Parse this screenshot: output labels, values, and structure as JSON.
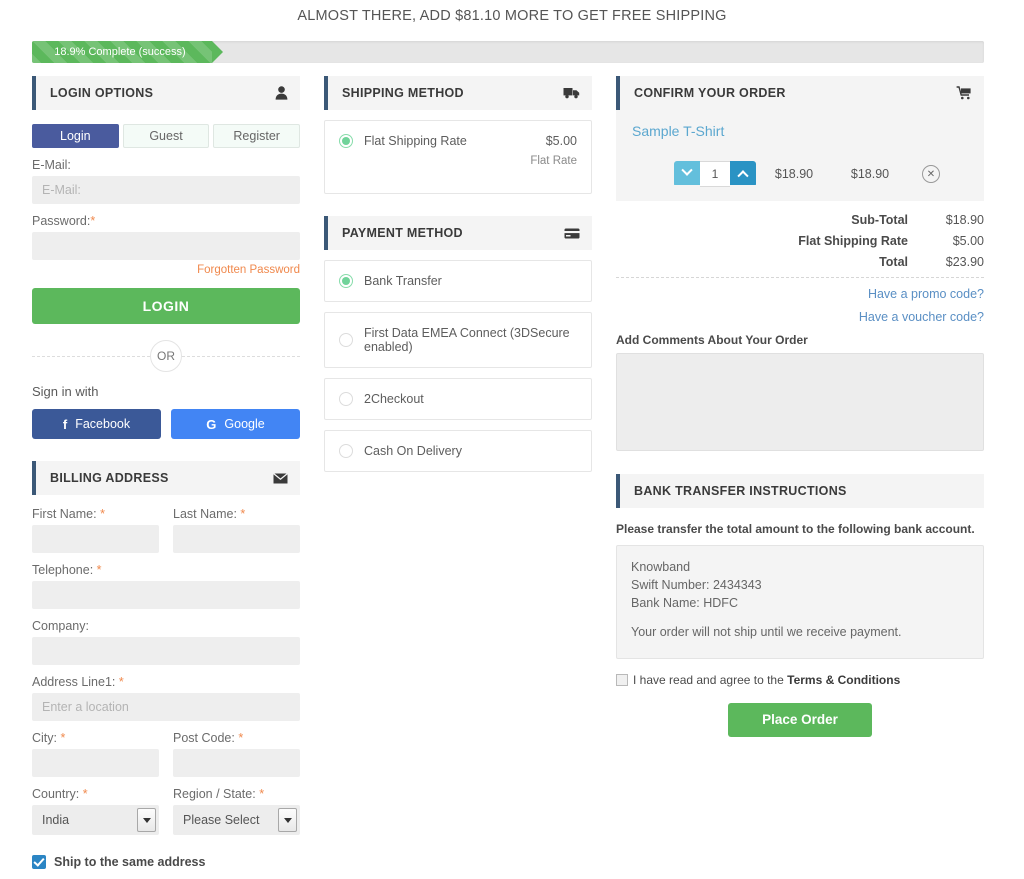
{
  "banner": {
    "free_shipping_message": "ALMOST THERE, ADD $81.10 MORE TO GET FREE SHIPPING"
  },
  "progress": {
    "label": "18.9% Complete (success)",
    "percent": "18.9",
    "bar_color": "#5cb85c",
    "track_color": "#e6e6e6"
  },
  "login_panel": {
    "title": "LOGIN OPTIONS",
    "icon": "user-icon",
    "tabs": [
      {
        "label": "Login",
        "active": true
      },
      {
        "label": "Guest",
        "active": false
      },
      {
        "label": "Register",
        "active": false
      }
    ],
    "email_label": "E-Mail:",
    "email_placeholder": "E-Mail:",
    "email_value": "",
    "password_label": "Password:",
    "password_required": "*",
    "password_value": "",
    "forgotten_password": "Forgotten Password",
    "login_button": "LOGIN",
    "or_text": "OR",
    "sign_in_with": "Sign in with",
    "facebook_label": "Facebook",
    "facebook_glyph": "f",
    "facebook_color": "#3b5998",
    "google_label": "Google",
    "google_glyph": "G",
    "google_color": "#4285f4"
  },
  "billing_panel": {
    "title": "BILLING ADDRESS",
    "icon": "envelope-icon",
    "first_name_label": "First Name:",
    "first_name_value": "",
    "last_name_label": "Last Name:",
    "last_name_value": "",
    "telephone_label": "Telephone:",
    "telephone_value": "",
    "company_label": "Company:",
    "company_value": "",
    "address1_label": "Address Line1:",
    "address1_placeholder": "Enter a location",
    "address1_value": "",
    "city_label": "City:",
    "city_value": "",
    "postcode_label": "Post Code:",
    "postcode_value": "",
    "country_label": "Country:",
    "country_value": "India",
    "region_label": "Region / State:",
    "region_value": "Please Select",
    "required_mark": "*",
    "ship_same_label": "Ship to the same address",
    "ship_same_checked": true
  },
  "shipping_panel": {
    "title": "SHIPPING METHOD",
    "icon": "truck-icon",
    "methods": [
      {
        "name": "Flat Shipping Rate",
        "price": "$5.00",
        "sub": "Flat Rate",
        "selected": true
      }
    ]
  },
  "payment_panel": {
    "title": "PAYMENT METHOD",
    "icon": "credit-card-icon",
    "methods": [
      {
        "name": "Bank Transfer",
        "selected": true
      },
      {
        "name": "First Data EMEA Connect (3DSecure enabled)",
        "selected": false
      },
      {
        "name": "2Checkout",
        "selected": false
      },
      {
        "name": "Cash On Delivery",
        "selected": false
      }
    ]
  },
  "order_panel": {
    "title": "CONFIRM YOUR ORDER",
    "icon": "cart-icon",
    "product": {
      "name": "Sample T-Shirt",
      "quantity": "1",
      "unit_price": "$18.90",
      "line_total": "$18.90",
      "remove_glyph": "✕"
    },
    "totals": [
      {
        "label": "Sub-Total",
        "value": "$18.90"
      },
      {
        "label": "Flat Shipping Rate",
        "value": "$5.00"
      },
      {
        "label": "Total",
        "value": "$23.90"
      }
    ],
    "promo_link": "Have a promo code?",
    "voucher_link": "Have a voucher code?",
    "comments_label": "Add Comments About Your Order",
    "comments_value": "",
    "comments_placeholder": ""
  },
  "bank_panel": {
    "title": "BANK TRANSFER INSTRUCTIONS",
    "note": "Please transfer the total amount to the following bank account.",
    "account_lines": [
      "Knowband",
      "Swift Number: 2434343",
      "Bank Name: HDFC"
    ],
    "ship_note": "Your order will not ship until we receive payment.",
    "terms_prefix": "I have read and agree to the ",
    "terms_link": "Terms & Conditions",
    "terms_checked": false,
    "place_order_button": "Place Order"
  },
  "colors": {
    "accent_bar": "#3b5877",
    "success_green": "#5cb85c",
    "link_blue": "#5a8fc4",
    "product_link": "#5ba7cf",
    "required_orange": "#f0894d",
    "login_tab_blue": "#4a5b9e"
  }
}
